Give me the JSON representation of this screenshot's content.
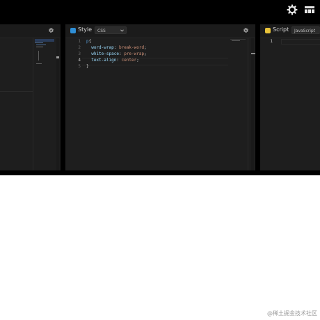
{
  "topbar": {
    "icons": [
      "gear-icon",
      "layout-grid-icon"
    ]
  },
  "style_panel": {
    "title": "Style",
    "language": "CSS",
    "icon": "css-badge-icon",
    "badge_color": "#2f8fd6",
    "code": [
      {
        "n": "1",
        "text": "p{"
      },
      {
        "n": "2",
        "text": "  word-wrap: break-word;"
      },
      {
        "n": "3",
        "text": "  white-space: pre-wrap;"
      },
      {
        "n": "4",
        "text": "  text-align: center;"
      },
      {
        "n": "5",
        "text": "}"
      }
    ]
  },
  "script_panel": {
    "title": "Script",
    "language": "JavaScript",
    "icon": "js-badge-icon",
    "badge_color": "#e8c33a",
    "code": [
      {
        "n": "1",
        "text": ""
      }
    ]
  },
  "watermark": "@稀土掘金技术社区"
}
